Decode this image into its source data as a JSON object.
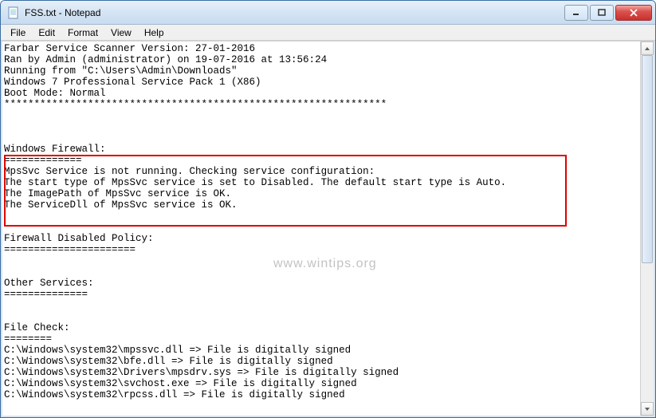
{
  "window": {
    "title": "FSS.txt - Notepad"
  },
  "menu": {
    "file": "File",
    "edit": "Edit",
    "format": "Format",
    "view": "View",
    "help": "Help"
  },
  "watermark": "www.wintips.org",
  "content": {
    "line1": "Farbar Service Scanner Version: 27-01-2016",
    "line2": "Ran by Admin (administrator) on 19-07-2016 at 13:56:24",
    "line3": "Running from \"C:\\Users\\Admin\\Downloads\"",
    "line4": "Windows 7 Professional Service Pack 1 (X86)",
    "line5": "Boot Mode: Normal",
    "line6": "****************************************************************",
    "blank1": "",
    "blank2": "",
    "blank3": "",
    "line7": "Windows Firewall:",
    "line8": "=============",
    "line9": "MpsSvc Service is not running. Checking service configuration:",
    "line10": "The start type of MpsSvc service is set to Disabled. The default start type is Auto.",
    "line11": "The ImagePath of MpsSvc service is OK.",
    "line12": "The ServiceDll of MpsSvc service is OK.",
    "blank4": "",
    "blank5": "",
    "line13": "Firewall Disabled Policy:",
    "line14": "======================",
    "blank6": "",
    "blank7": "",
    "line15": "Other Services:",
    "line16": "==============",
    "blank8": "",
    "blank9": "",
    "line17": "File Check:",
    "line18": "========",
    "line19": "C:\\Windows\\system32\\mpssvc.dll => File is digitally signed",
    "line20": "C:\\Windows\\system32\\bfe.dll => File is digitally signed",
    "line21": "C:\\Windows\\system32\\Drivers\\mpsdrv.sys => File is digitally signed",
    "line22": "C:\\Windows\\system32\\svchost.exe => File is digitally signed",
    "line23": "C:\\Windows\\system32\\rpcss.dll => File is digitally signed"
  }
}
